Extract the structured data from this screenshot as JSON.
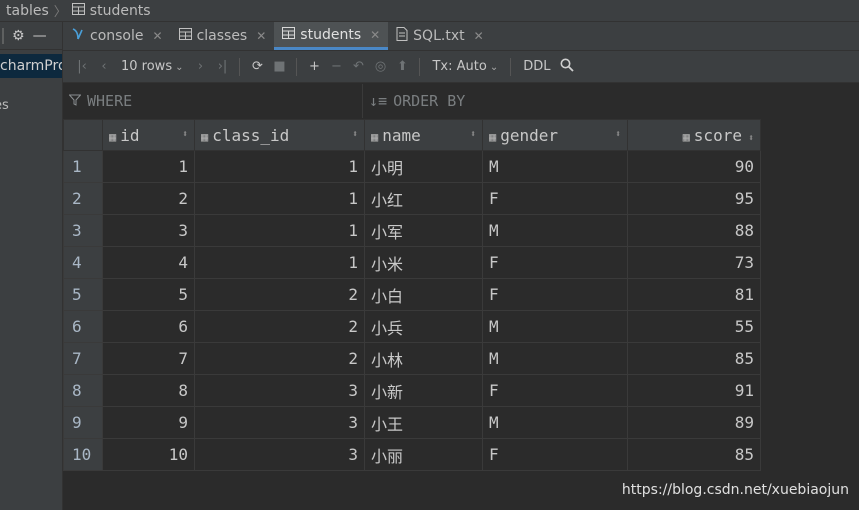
{
  "breadcrumb": {
    "parent": "tables",
    "current": "students"
  },
  "left_panel": {
    "project_label": "charmPro",
    "partial_item": "es"
  },
  "tabs": [
    {
      "label": "console",
      "icon": "console-icon",
      "active": false
    },
    {
      "label": "classes",
      "icon": "table-icon",
      "active": false
    },
    {
      "label": "students",
      "icon": "table-icon",
      "active": true
    },
    {
      "label": "SQL.txt",
      "icon": "text-file-icon",
      "active": false
    }
  ],
  "toolbar": {
    "rows_label": "10 rows",
    "tx_label": "Tx: Auto",
    "ddl_label": "DDL"
  },
  "filter": {
    "where_label": "WHERE",
    "order_label": "ORDER BY"
  },
  "table": {
    "columns": [
      "id",
      "class_id",
      "name",
      "gender",
      "score"
    ],
    "rows": [
      {
        "n": "1",
        "id": "1",
        "class_id": "1",
        "name": "小明",
        "gender": "M",
        "score": "90"
      },
      {
        "n": "2",
        "id": "2",
        "class_id": "1",
        "name": "小红",
        "gender": "F",
        "score": "95"
      },
      {
        "n": "3",
        "id": "3",
        "class_id": "1",
        "name": "小军",
        "gender": "M",
        "score": "88"
      },
      {
        "n": "4",
        "id": "4",
        "class_id": "1",
        "name": "小米",
        "gender": "F",
        "score": "73"
      },
      {
        "n": "5",
        "id": "5",
        "class_id": "2",
        "name": "小白",
        "gender": "F",
        "score": "81"
      },
      {
        "n": "6",
        "id": "6",
        "class_id": "2",
        "name": "小兵",
        "gender": "M",
        "score": "55"
      },
      {
        "n": "7",
        "id": "7",
        "class_id": "2",
        "name": "小林",
        "gender": "M",
        "score": "85"
      },
      {
        "n": "8",
        "id": "8",
        "class_id": "3",
        "name": "小新",
        "gender": "F",
        "score": "91"
      },
      {
        "n": "9",
        "id": "9",
        "class_id": "3",
        "name": "小王",
        "gender": "M",
        "score": "89"
      },
      {
        "n": "10",
        "id": "10",
        "class_id": "3",
        "name": "小丽",
        "gender": "F",
        "score": "85"
      }
    ]
  },
  "watermark": "https://blog.csdn.net/xuebiaojun",
  "colors": {
    "active_tab_underline": "#4a88c7",
    "background": "#2b2b2b",
    "panel": "#3c3f41"
  }
}
